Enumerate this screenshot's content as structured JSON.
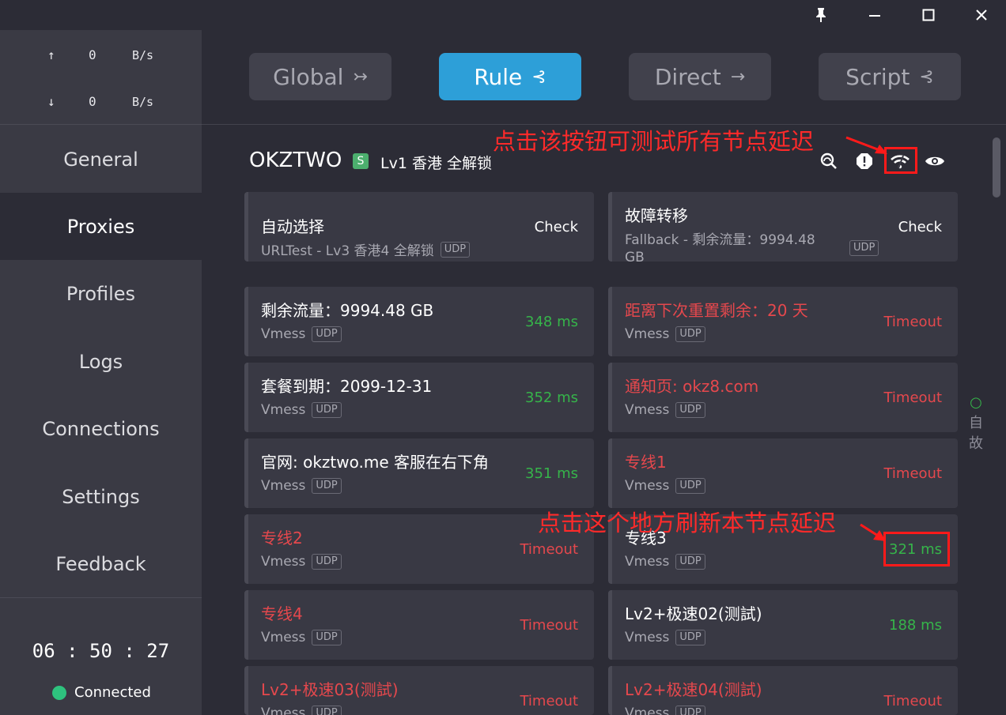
{
  "window": {
    "pin_icon": "pin-icon",
    "minimize_icon": "minimize-icon",
    "maximize_icon": "maximize-icon",
    "close_icon": "close-icon"
  },
  "traffic": {
    "up_arrow": "↑",
    "up_value": "0",
    "up_unit": "B/s",
    "down_arrow": "↓",
    "down_value": "0",
    "down_unit": "B/s"
  },
  "nav": [
    {
      "label": "General"
    },
    {
      "label": "Proxies"
    },
    {
      "label": "Profiles"
    },
    {
      "label": "Logs"
    },
    {
      "label": "Connections"
    },
    {
      "label": "Settings"
    },
    {
      "label": "Feedback"
    }
  ],
  "clock": "06 : 50 : 27",
  "status": {
    "label": "Connected",
    "color": "#2ec27e"
  },
  "modes": [
    {
      "label": "Global",
      "glyph": "↣"
    },
    {
      "label": "Rule",
      "glyph": "⊰",
      "active": true
    },
    {
      "label": "Direct",
      "glyph": "→"
    },
    {
      "label": "Script",
      "glyph": "⊰"
    }
  ],
  "group": {
    "name": "OKZTWO",
    "badge": "S",
    "selected": "Lv1 香港 全解锁"
  },
  "header_icons": [
    "search-latency-icon",
    "alert-icon",
    "speedtest-icon",
    "eye-icon"
  ],
  "proxies": [
    {
      "name": "自动选择",
      "type": "URLTest - Lv3 香港4 全解锁",
      "udp": "UDP",
      "right": "Check",
      "status": "check"
    },
    {
      "name": "故障转移",
      "type": "Fallback - 剩余流量：9994.48",
      "type2": "GB",
      "udp": "UDP",
      "right": "Check",
      "status": "check"
    },
    {
      "name": "剩余流量：9994.48 GB",
      "type": "Vmess",
      "udp": "UDP",
      "right": "348 ms",
      "status": "ok"
    },
    {
      "name": "距离下次重置剩余：20 天",
      "type": "Vmess",
      "udp": "UDP",
      "right": "Timeout",
      "status": "timeout"
    },
    {
      "name": "套餐到期：2099-12-31",
      "type": "Vmess",
      "udp": "UDP",
      "right": "352 ms",
      "status": "ok"
    },
    {
      "name": "通知页: okz8.com",
      "type": "Vmess",
      "udp": "UDP",
      "right": "Timeout",
      "status": "timeout"
    },
    {
      "name": "官网: okztwo.me 客服在右下角",
      "type": "Vmess",
      "udp": "UDP",
      "right": "351 ms",
      "status": "ok"
    },
    {
      "name": "专线1",
      "type": "Vmess",
      "udp": "UDP",
      "right": "Timeout",
      "status": "timeout"
    },
    {
      "name": "专线2",
      "type": "Vmess",
      "udp": "UDP",
      "right": "Timeout",
      "status": "timeout"
    },
    {
      "name": "专线3",
      "type": "Vmess",
      "udp": "UDP",
      "right": "321 ms",
      "status": "ok"
    },
    {
      "name": "专线4",
      "type": "Vmess",
      "udp": "UDP",
      "right": "Timeout",
      "status": "timeout"
    },
    {
      "name": "Lv2+极速02(测試)",
      "type": "Vmess",
      "udp": "UDP",
      "right": "188 ms",
      "status": "ok"
    },
    {
      "name": "Lv2+极速03(测試)",
      "type": "Vmess",
      "udp": "UDP",
      "right": "Timeout",
      "status": "timeout"
    },
    {
      "name": "Lv2+极速04(测試)",
      "type": "Vmess",
      "udp": "UDP",
      "right": "Timeout",
      "status": "timeout"
    }
  ],
  "annotations": {
    "test_all": "点击该按钮可测试所有节点延迟",
    "refresh_one": "点击这个地方刷新本节点延迟"
  },
  "edge_text": [
    "○",
    "自",
    "故"
  ],
  "colors": {
    "accent": "#2d9fd8",
    "ok": "#36b44a",
    "timeout": "#e5484d",
    "annotation": "#ff2a2a"
  }
}
